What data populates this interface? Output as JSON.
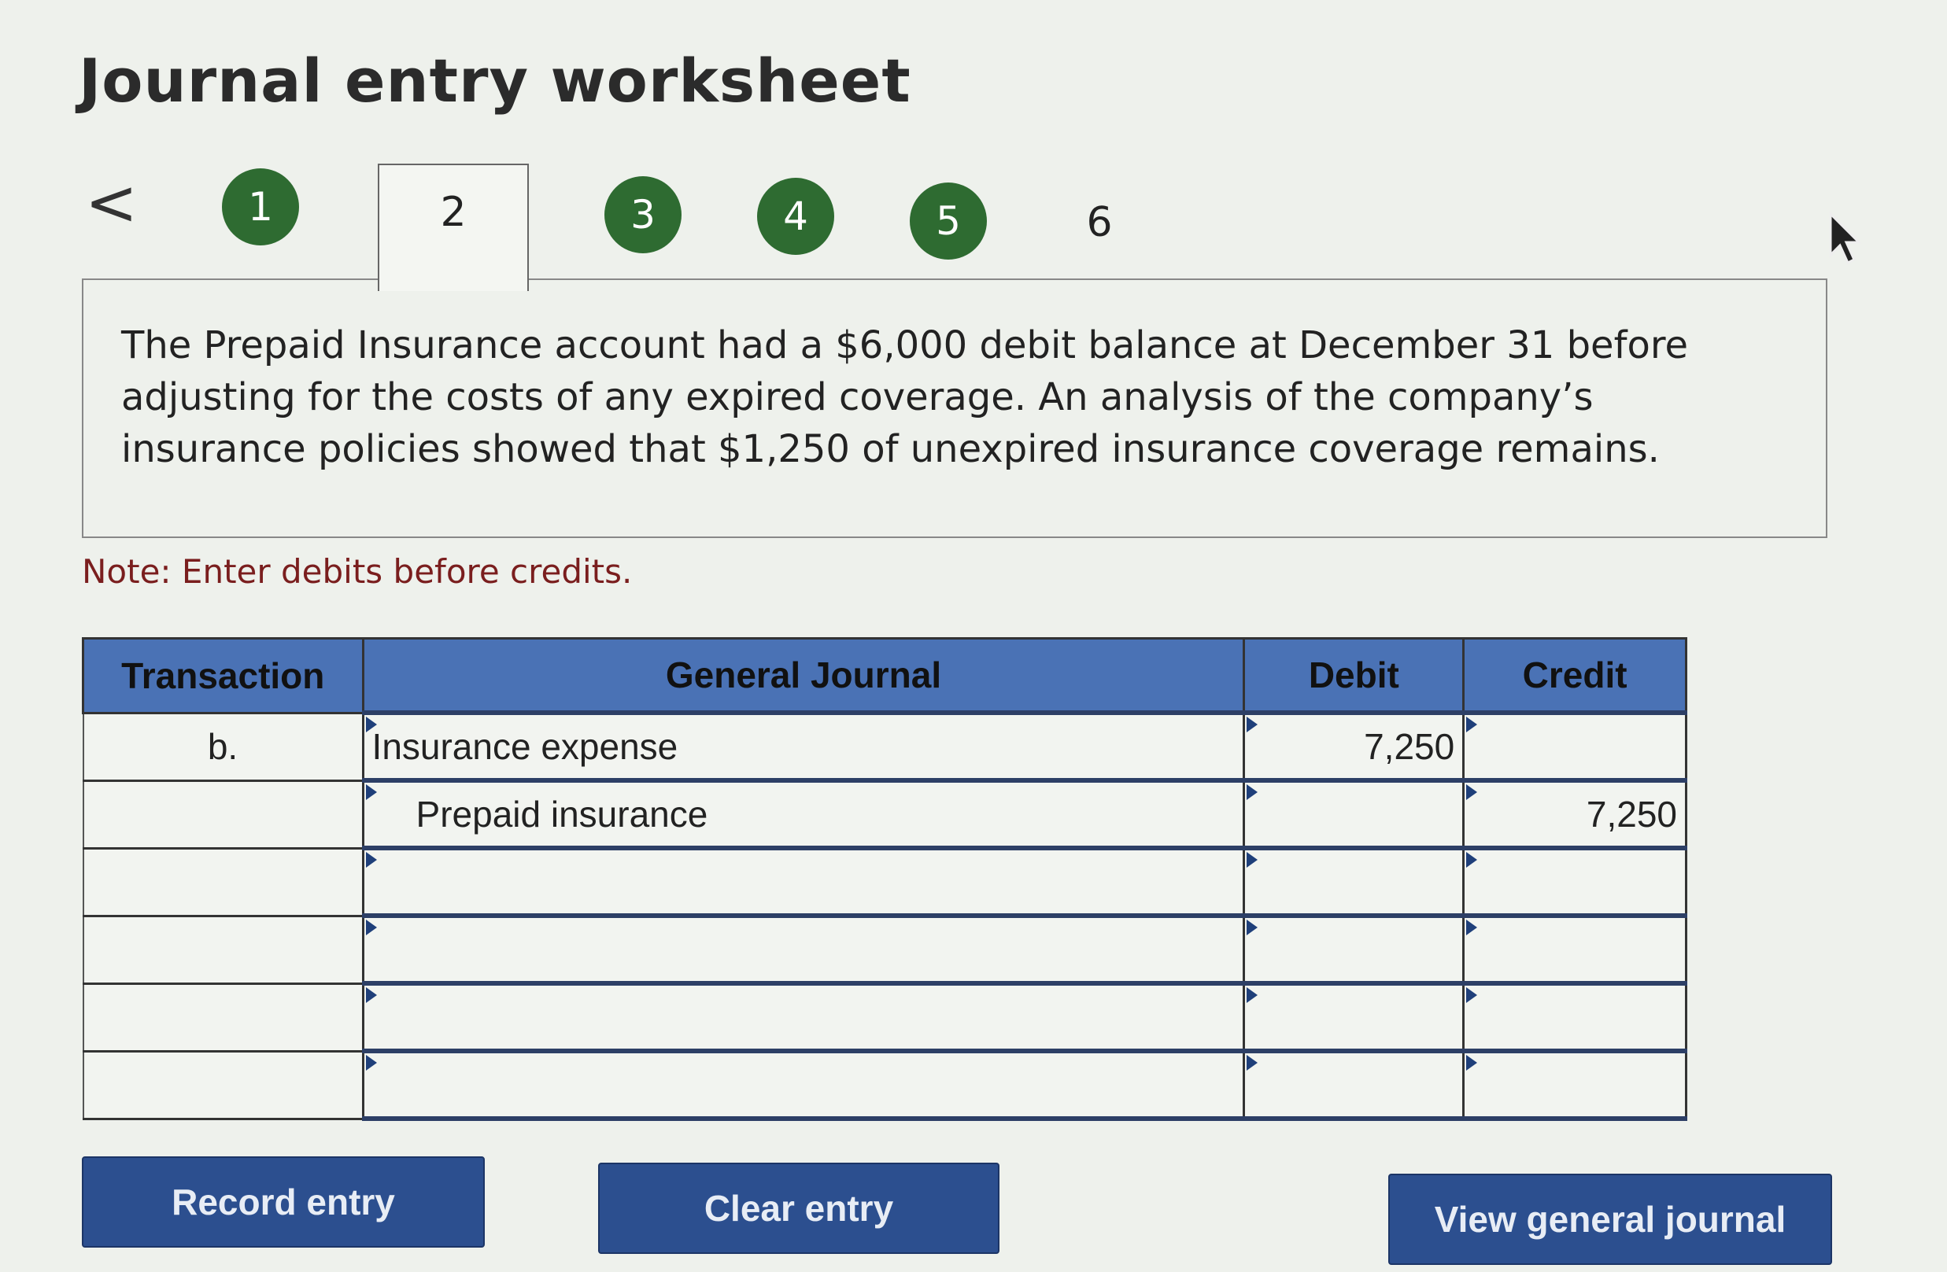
{
  "page": {
    "title": "Journal entry worksheet"
  },
  "nav": {
    "prev_symbol": "<",
    "steps": [
      {
        "label": "1",
        "state": "completed"
      },
      {
        "label": "2",
        "state": "active"
      },
      {
        "label": "3",
        "state": "completed"
      },
      {
        "label": "4",
        "state": "completed"
      },
      {
        "label": "5",
        "state": "completed"
      },
      {
        "label": "6",
        "state": "pending"
      }
    ]
  },
  "question": {
    "text": "The Prepaid Insurance account had a $6,000 debit balance at December 31 before adjusting for the costs of any expired coverage. An analysis of the company’s insurance policies showed that $1,250 of unexpired insurance coverage remains."
  },
  "note": "Note: Enter debits before credits.",
  "table": {
    "headers": {
      "transaction": "Transaction",
      "general_journal": "General Journal",
      "debit": "Debit",
      "credit": "Credit"
    },
    "rows": [
      {
        "transaction": "b.",
        "account": "Insurance expense",
        "debit": "7,250",
        "credit": ""
      },
      {
        "transaction": "",
        "account": "Prepaid insurance",
        "debit": "",
        "credit": "7,250"
      },
      {
        "transaction": "",
        "account": "",
        "debit": "",
        "credit": ""
      },
      {
        "transaction": "",
        "account": "",
        "debit": "",
        "credit": ""
      },
      {
        "transaction": "",
        "account": "",
        "debit": "",
        "credit": ""
      },
      {
        "transaction": "",
        "account": "",
        "debit": "",
        "credit": ""
      }
    ]
  },
  "buttons": {
    "record": "Record entry",
    "clear": "Clear entry",
    "view": "View general journal"
  },
  "colors": {
    "step_green": "#2e6b31",
    "header_blue": "#4a72b5",
    "button_blue": "#2c4f8f",
    "note_red": "#7a1e1e"
  }
}
